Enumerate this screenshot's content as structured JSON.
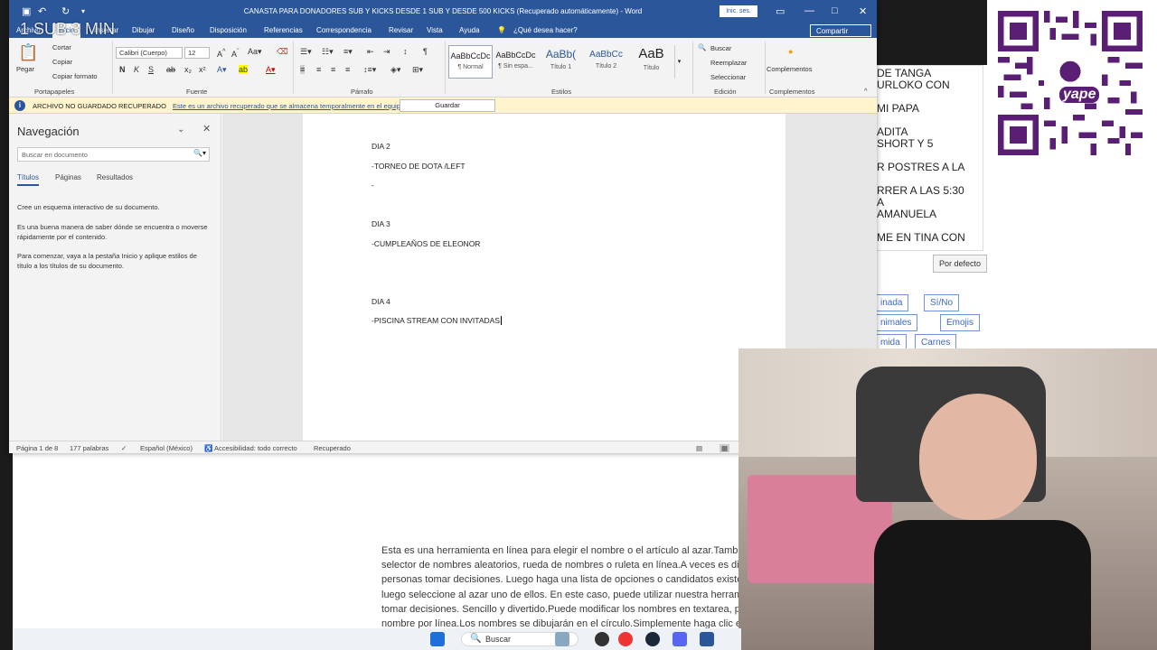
{
  "word": {
    "title": "CANASTA PARA DONADORES SUB Y KICKS DESDE 1 SUB Y DESDE 500 KICKS (Recuperado automáticamente) - Word",
    "signin": "Inic. ses.",
    "tabs": [
      "Archivo",
      "Inicio",
      "Insertar",
      "Dibujar",
      "Diseño",
      "Disposición",
      "Referencias",
      "Correspondencia",
      "Revisar",
      "Vista",
      "Ayuda"
    ],
    "tell_me": "¿Qué desea hacer?",
    "share": "Compartir",
    "ribbon": {
      "paste": "Pegar",
      "cut": "Cortar",
      "copy": "Copiar",
      "copy_format": "Copiar formato",
      "clipboard_label": "Portapapeles",
      "font_name": "Calibri (Cuerpo)",
      "font_size": "12",
      "font_label": "Fuente",
      "paragraph_label": "Párrafo",
      "styles_label": "Estilos",
      "styles": [
        {
          "sample": "AaBbCcDc",
          "name": "¶ Normal"
        },
        {
          "sample": "AaBbCcDc",
          "name": "¶ Sin espa..."
        },
        {
          "sample": "AaBb(",
          "name": "Título 1"
        },
        {
          "sample": "AaBbCc",
          "name": "Título 2"
        },
        {
          "sample": "AaB",
          "name": "Título"
        }
      ],
      "find": "Buscar",
      "replace": "Reemplazar",
      "select": "Seleccionar",
      "editing_label": "Edición",
      "addins": "Complementos",
      "addins_label": "Complementos"
    },
    "infobar": {
      "title": "ARCHIVO NO GUARDADO RECUPERADO",
      "message": "Este es un archivo recuperado que se almacena temporalmente en el equipo.",
      "button": "Guardar"
    },
    "nav": {
      "title": "Navegación",
      "search_placeholder": "Buscar en documento",
      "tabs": [
        "Títulos",
        "Páginas",
        "Resultados"
      ],
      "p1": "Cree un esquema interactivo de su documento.",
      "p2": "Es una buena manera de saber dónde se encuentra o moverse rápidamente por el contenido.",
      "p3": "Para comenzar, vaya a la pestaña Inicio y aplique estilos de título a los títulos de su documento."
    },
    "document_lines": [
      "DIA 2",
      "-TORNEO DE DOTA /LEFT",
      "-",
      "DIA 3",
      "-CUMPLEAÑOS DE ELEONOR",
      "DIA 4",
      "-PISCINA STREAM CON INVITADAS"
    ],
    "status": {
      "page": "Página 1 de 8",
      "words": "177 palabras",
      "language": "Español (México)",
      "accessibility": "Accesibilidad: todo correcto",
      "recovered": "Recuperado"
    }
  },
  "overlay_text": "1 SUB 3 MIN",
  "roulette": {
    "names": [
      "DE TANGA",
      "URLOKO CON",
      "",
      "MI PAPA",
      "",
      "ADITA",
      "SHORT Y 5",
      "",
      "R  POSTRES A  LA",
      "",
      "RRER A LAS 5:30",
      "A",
      "AMANUELA",
      "",
      "ME EN TINA CON"
    ],
    "default_button": "Por defecto",
    "buttons": [
      "inada",
      "Sí/No",
      "nimales",
      "Emojis",
      "mida",
      "Carnes"
    ]
  },
  "qr_brand": "yape",
  "background_text": [
    "Esta es una herramienta en línea para elegir el nombre o el artículo al azar.También",
    "selector de nombres aleatorios, rueda de nombres o ruleta en línea.A veces es difíci",
    "personas tomar decisiones. Luego haga una lista de opciones o candidatos existen",
    "luego seleccione al azar uno de ellos. En este caso, puede utilizar nuestra herramie",
    "tomar decisiones. Sencillo y divertido.Puede modificar los nombres en textarea, po",
    "nombre por línea.Los nombres se dibujarán en el círculo.Simplemente haga clic en"
  ],
  "taskbar": {
    "search": "Buscar"
  }
}
